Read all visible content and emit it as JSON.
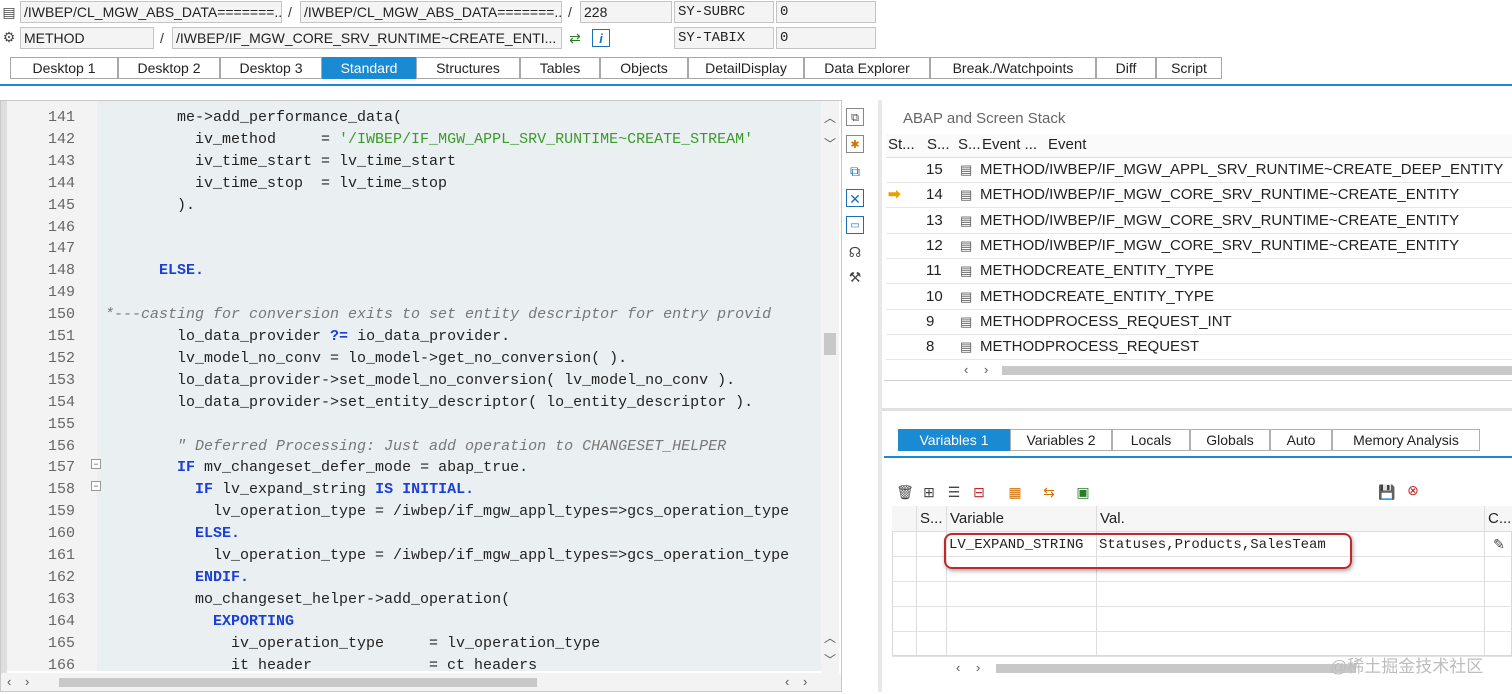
{
  "top_fields": {
    "row1": {
      "program": "/IWBEP/CL_MGW_ABS_DATA=======...",
      "include": "/IWBEP/CL_MGW_ABS_DATA=======...",
      "line": "228",
      "sysvar_name": "SY-SUBRC",
      "sysvar_value": "0"
    },
    "row2": {
      "type": "METHOD",
      "method": "/IWBEP/IF_MGW_CORE_SRV_RUNTIME~CREATE_ENTI...",
      "sysvar_name": "SY-TABIX",
      "sysvar_value": "0"
    },
    "slash": "/"
  },
  "main_tabs": [
    "Desktop 1",
    "Desktop 2",
    "Desktop 3",
    "Standard",
    "Structures",
    "Tables",
    "Objects",
    "DetailDisplay",
    "Data Explorer",
    "Break./Watchpoints",
    "Diff",
    "Script"
  ],
  "code": [
    {
      "n": "141",
      "parts": [
        {
          "t": "        me->add_performance_data(",
          "c": ""
        }
      ]
    },
    {
      "n": "142",
      "parts": [
        {
          "t": "          iv_method     = ",
          "c": ""
        },
        {
          "t": "'/IWBEP/IF_MGW_APPL_SRV_RUNTIME~CREATE_STREAM'",
          "c": "str"
        }
      ]
    },
    {
      "n": "143",
      "parts": [
        {
          "t": "          iv_time_start = lv_time_start",
          "c": ""
        }
      ]
    },
    {
      "n": "144",
      "parts": [
        {
          "t": "          iv_time_stop  = lv_time_stop",
          "c": ""
        }
      ]
    },
    {
      "n": "145",
      "parts": [
        {
          "t": "        ).",
          "c": ""
        }
      ]
    },
    {
      "n": "146",
      "parts": [
        {
          "t": "",
          "c": ""
        }
      ]
    },
    {
      "n": "147",
      "parts": [
        {
          "t": "",
          "c": ""
        }
      ]
    },
    {
      "n": "148",
      "parts": [
        {
          "t": "      ",
          "c": ""
        },
        {
          "t": "ELSE.",
          "c": "kw"
        }
      ]
    },
    {
      "n": "149",
      "parts": [
        {
          "t": "",
          "c": ""
        }
      ]
    },
    {
      "n": "150",
      "parts": [
        {
          "t": "*---casting for conversion exits to set entity descriptor for entry provid",
          "c": "cmt"
        }
      ]
    },
    {
      "n": "151",
      "parts": [
        {
          "t": "        lo_data_provider ",
          "c": ""
        },
        {
          "t": "?=",
          "c": "kw"
        },
        {
          "t": " io_data_provider.",
          "c": ""
        }
      ]
    },
    {
      "n": "152",
      "parts": [
        {
          "t": "        lv_model_no_conv = lo_model->get_no_conversion( ).",
          "c": ""
        }
      ]
    },
    {
      "n": "153",
      "parts": [
        {
          "t": "        lo_data_provider->set_model_no_conversion( lv_model_no_conv ).",
          "c": ""
        }
      ]
    },
    {
      "n": "154",
      "parts": [
        {
          "t": "        lo_data_provider->set_entity_descriptor( lo_entity_descriptor ).",
          "c": ""
        }
      ]
    },
    {
      "n": "155",
      "parts": [
        {
          "t": "",
          "c": ""
        }
      ]
    },
    {
      "n": "156",
      "parts": [
        {
          "t": "        \" Deferred Processing: Just add operation to CHANGESET_HELPER",
          "c": "cmt"
        }
      ]
    },
    {
      "n": "157",
      "parts": [
        {
          "t": "        ",
          "c": ""
        },
        {
          "t": "IF",
          "c": "kw"
        },
        {
          "t": " mv_changeset_defer_mode = abap_true.",
          "c": ""
        }
      ]
    },
    {
      "n": "158",
      "parts": [
        {
          "t": "          ",
          "c": ""
        },
        {
          "t": "IF",
          "c": "kw"
        },
        {
          "t": " lv_expand_string ",
          "c": ""
        },
        {
          "t": "IS INITIAL.",
          "c": "kw"
        }
      ]
    },
    {
      "n": "159",
      "parts": [
        {
          "t": "            lv_operation_type = /iwbep/if_mgw_appl_types=>gcs_operation_type",
          "c": ""
        }
      ]
    },
    {
      "n": "160",
      "parts": [
        {
          "t": "          ",
          "c": ""
        },
        {
          "t": "ELSE.",
          "c": "kw"
        }
      ]
    },
    {
      "n": "161",
      "parts": [
        {
          "t": "            lv_operation_type = /iwbep/if_mgw_appl_types=>gcs_operation_type",
          "c": ""
        }
      ]
    },
    {
      "n": "162",
      "parts": [
        {
          "t": "          ",
          "c": ""
        },
        {
          "t": "ENDIF.",
          "c": "kw"
        }
      ]
    },
    {
      "n": "163",
      "parts": [
        {
          "t": "          mo_changeset_helper->add_operation(",
          "c": ""
        }
      ]
    },
    {
      "n": "164",
      "parts": [
        {
          "t": "            ",
          "c": ""
        },
        {
          "t": "EXPORTING",
          "c": "kw"
        }
      ]
    },
    {
      "n": "165",
      "parts": [
        {
          "t": "              iv_operation_type     = lv_operation_type",
          "c": ""
        }
      ]
    },
    {
      "n": "166",
      "parts": [
        {
          "t": "              it header             = ct headers",
          "c": ""
        }
      ]
    }
  ],
  "stack": {
    "title": "ABAP and Screen Stack",
    "headers": [
      "St...",
      "S...",
      "S...",
      "Event ...",
      "Event"
    ],
    "rows": [
      {
        "level": "15",
        "type": "METHOD",
        "event": "/IWBEP/IF_MGW_APPL_SRV_RUNTIME~CREATE_DEEP_ENTITY",
        "current": false
      },
      {
        "level": "14",
        "type": "METHOD",
        "event": "/IWBEP/IF_MGW_CORE_SRV_RUNTIME~CREATE_ENTITY",
        "current": true
      },
      {
        "level": "13",
        "type": "METHOD",
        "event": "/IWBEP/IF_MGW_CORE_SRV_RUNTIME~CREATE_ENTITY",
        "current": false
      },
      {
        "level": "12",
        "type": "METHOD",
        "event": "/IWBEP/IF_MGW_CORE_SRV_RUNTIME~CREATE_ENTITY",
        "current": false
      },
      {
        "level": "11",
        "type": "METHOD",
        "event": "CREATE_ENTITY_TYPE",
        "current": false
      },
      {
        "level": "10",
        "type": "METHOD",
        "event": "CREATE_ENTITY_TYPE",
        "current": false
      },
      {
        "level": "9",
        "type": "METHOD",
        "event": "PROCESS_REQUEST_INT",
        "current": false
      },
      {
        "level": "8",
        "type": "METHOD",
        "event": "PROCESS_REQUEST",
        "current": false
      }
    ]
  },
  "var_tabs": [
    "Variables 1",
    "Variables 2",
    "Locals",
    "Globals",
    "Auto",
    "Memory Analysis"
  ],
  "var_grid": {
    "headers": [
      "S...",
      "Variable",
      "Val.",
      "C..."
    ],
    "rows": [
      {
        "variable": "LV_EXPAND_STRING",
        "value": "Statuses,Products,SalesTeam"
      }
    ]
  },
  "watermark": "@稀土掘金技术社区",
  "colors": {
    "accent": "#1a8ad3",
    "highlight": "#c0282a",
    "keyword": "#1b3fd6",
    "string": "#3c9a2c"
  }
}
